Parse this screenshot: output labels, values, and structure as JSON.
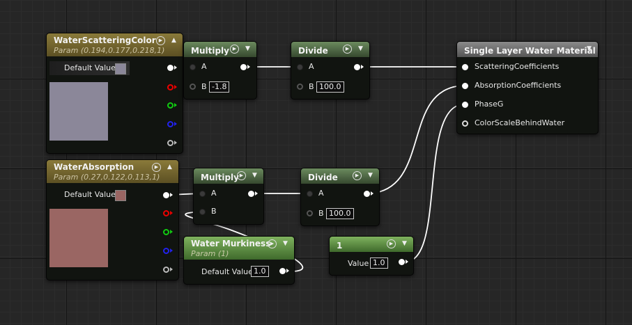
{
  "nodes": {
    "scattering_color": {
      "title": "WaterScatteringColor",
      "subtitle": "Param (0.194,0.177,0.218,1)",
      "default_label": "Default Value",
      "swatch_color": "#8b8799",
      "preview_color": "#8b8799"
    },
    "absorption": {
      "title": "WaterAbsorption",
      "subtitle": "Param (0.27,0.122,0.113,1)",
      "default_label": "Default Value",
      "swatch_color": "#9a6663",
      "preview_color": "#9a6663"
    },
    "multiply_top": {
      "title": "Multiply",
      "pin_a": "A",
      "pin_b": "B",
      "b_value": "-1.8"
    },
    "divide_top": {
      "title": "Divide",
      "pin_a": "A",
      "pin_b": "B",
      "b_value": "100.0"
    },
    "multiply_bottom": {
      "title": "Multiply",
      "pin_a": "A",
      "pin_b": "B"
    },
    "divide_bottom": {
      "title": "Divide",
      "pin_a": "A",
      "pin_b": "B",
      "b_value": "100.0"
    },
    "water_murkiness": {
      "title": "Water Murkiness",
      "subtitle": "Param (1)",
      "default_label": "Default Value",
      "default_value": "1.0"
    },
    "constant": {
      "title": "1",
      "value_label": "Value",
      "value": "1.0"
    },
    "material": {
      "title": "Single Layer Water Material",
      "pins": [
        "ScatteringCoefficients",
        "AbsorptionCoefficients",
        "PhaseG",
        "ColorScaleBehindWater"
      ]
    }
  },
  "colors": {
    "param_header": "#7a6b31",
    "math_header": "#56704b",
    "constant_header": "#6a9a4e",
    "result_header": "#777777",
    "wire": "#ffffff"
  },
  "icons": {
    "collapse": "chevron-down-icon",
    "preview": "play-circle-icon",
    "expand_up": "chevron-up-icon"
  }
}
